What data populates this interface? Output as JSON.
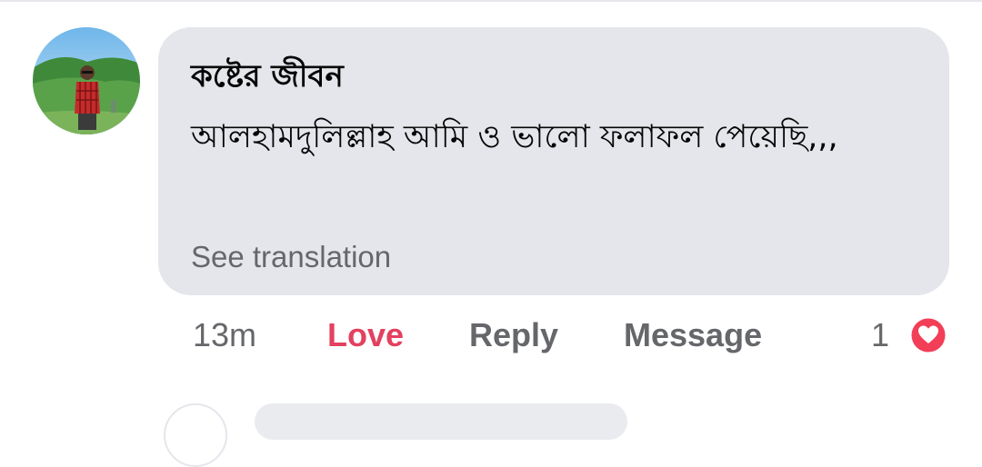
{
  "comment": {
    "author": "কষ্টের জীবন",
    "text": "আলহামদুলিল্লাহ আমি ও ভালো ফলাফল পেয়েছি,,,",
    "see_translation": "See translation",
    "timestamp": "13m",
    "love_label": "Love",
    "reply_label": "Reply",
    "message_label": "Message",
    "reaction_count": "1",
    "reaction_icon": "heart-icon"
  },
  "colors": {
    "bubble_bg": "#e4e6eb",
    "love_accent": "#e4405f",
    "muted_text": "#65676b",
    "primary_text": "#050505"
  }
}
